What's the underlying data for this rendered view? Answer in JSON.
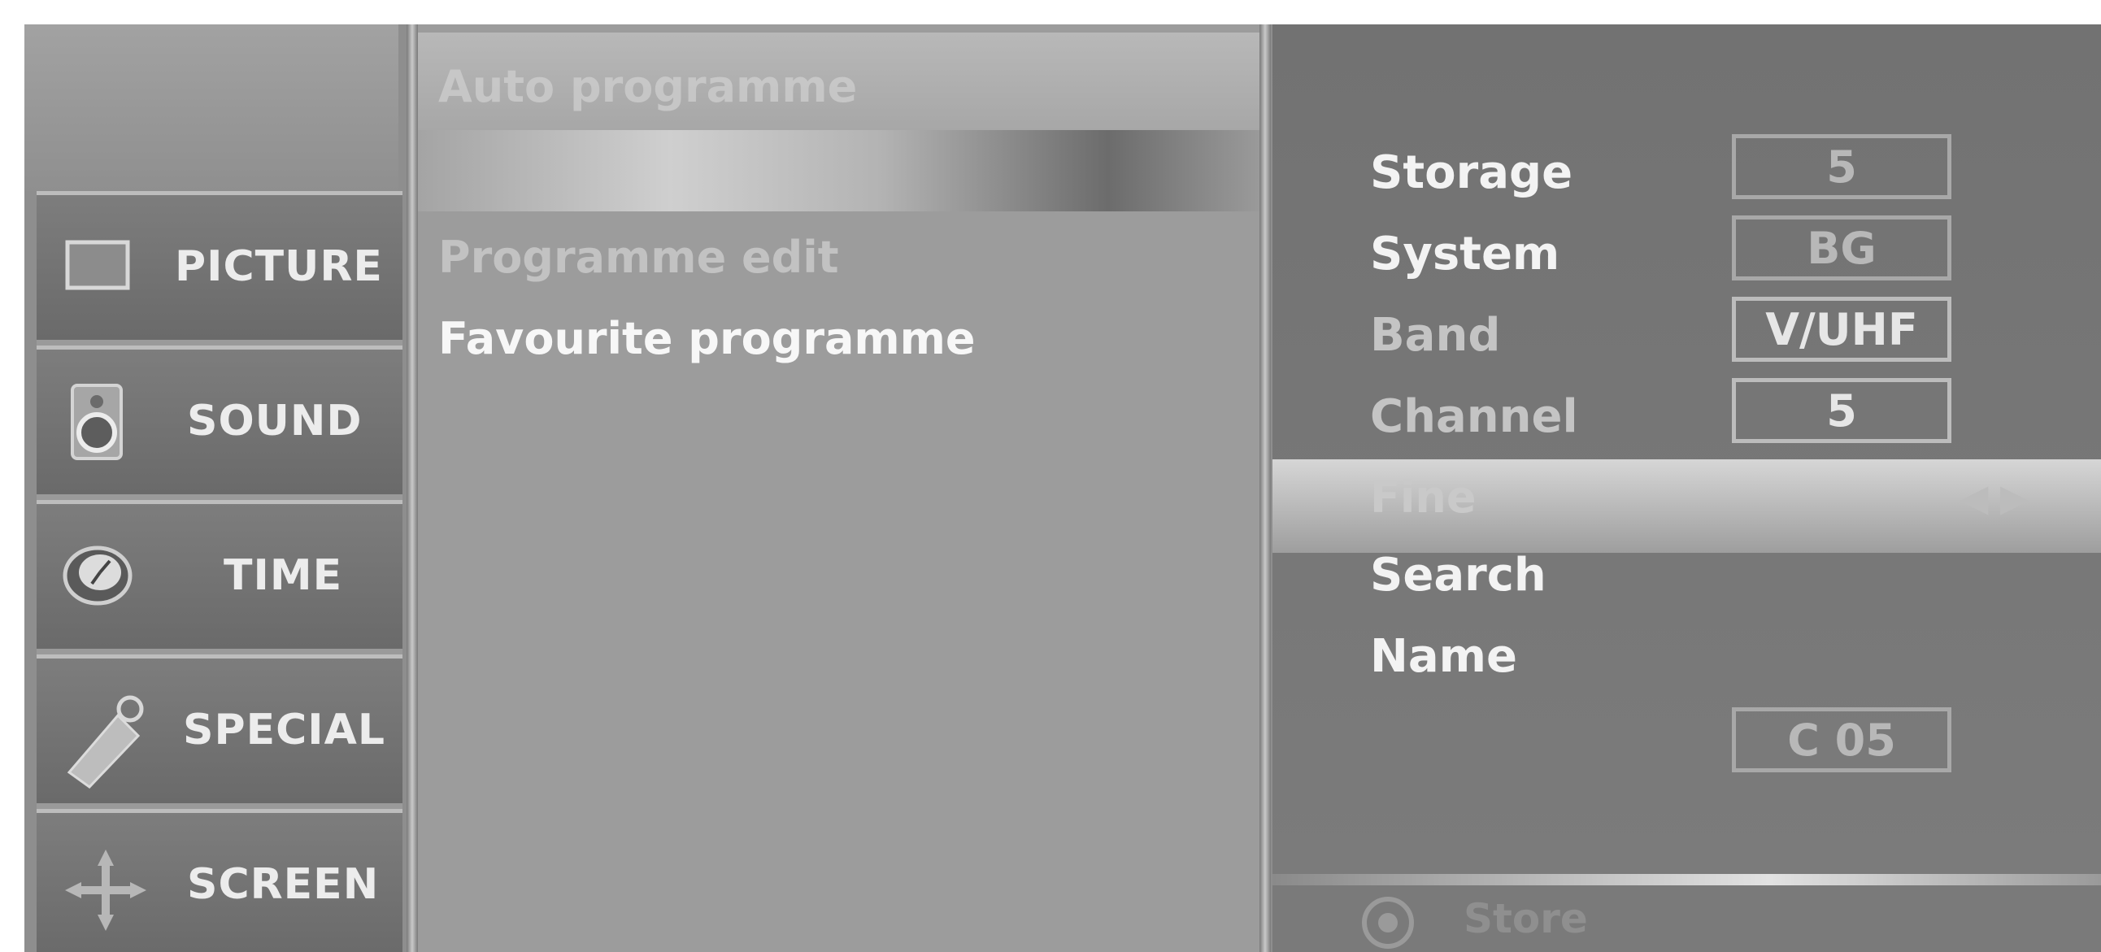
{
  "categories": [
    {
      "label": "PICTURE",
      "icon": "picture-icon"
    },
    {
      "label": "SOUND",
      "icon": "speaker-icon"
    },
    {
      "label": "TIME",
      "icon": "clock-icon"
    },
    {
      "label": "SPECIAL",
      "icon": "special-tag-icon"
    },
    {
      "label": "SCREEN",
      "icon": "screen-move-icon"
    }
  ],
  "submenu": {
    "auto": "Auto programme",
    "edit": "Programme edit",
    "favourite": "Favourite programme"
  },
  "settings": {
    "storage": {
      "label": "Storage",
      "value": "5"
    },
    "system": {
      "label": "System",
      "value": "BG"
    },
    "band": {
      "label": "Band",
      "value": "V/UHF"
    },
    "channel": {
      "label": "Channel",
      "value": "5"
    },
    "fine": {
      "label": "Fine",
      "arrows": "◀ ▶"
    },
    "search": {
      "label": "Search"
    },
    "name": {
      "label": "Name",
      "value": "C 05"
    },
    "store": {
      "label": "Store"
    }
  }
}
